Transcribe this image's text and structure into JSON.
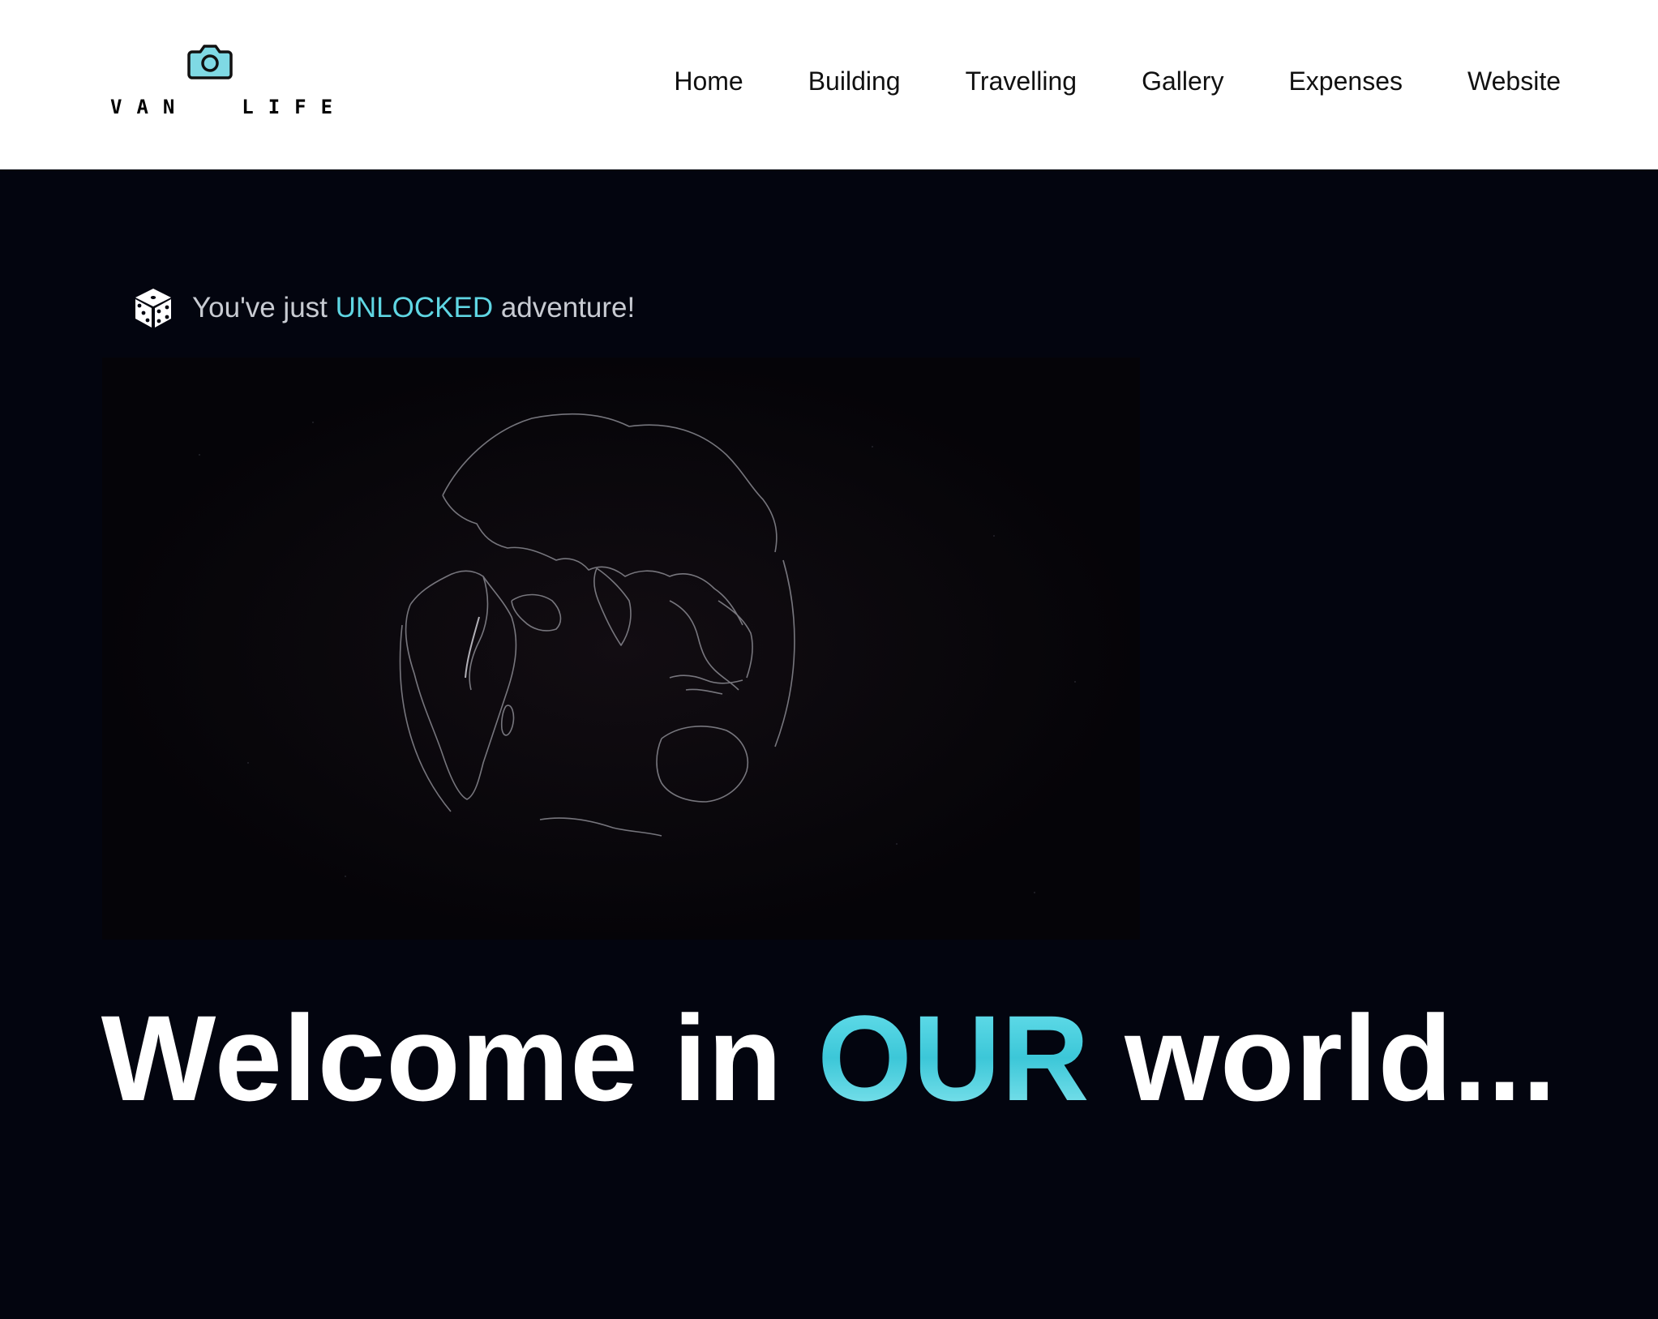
{
  "header": {
    "logo_text": "VAN  LIFE",
    "logo_icon": "camera-icon",
    "nav": [
      {
        "label": "Home"
      },
      {
        "label": "Building"
      },
      {
        "label": "Travelling"
      },
      {
        "label": "Gallery"
      },
      {
        "label": "Expenses"
      },
      {
        "label": "Website"
      }
    ]
  },
  "hero": {
    "unlock_icon": "dice-icon",
    "unlock_prefix": "You've just ",
    "unlock_accent": "UNLOCKED",
    "unlock_suffix": " adventure!",
    "headline_prefix": "Welcome in ",
    "headline_accent": "OUR",
    "headline_suffix": " world...",
    "media_icon": "globe-video"
  },
  "colors": {
    "accent": "#5fd6e3",
    "background": "#03050f",
    "header_bg": "#ffffff"
  }
}
